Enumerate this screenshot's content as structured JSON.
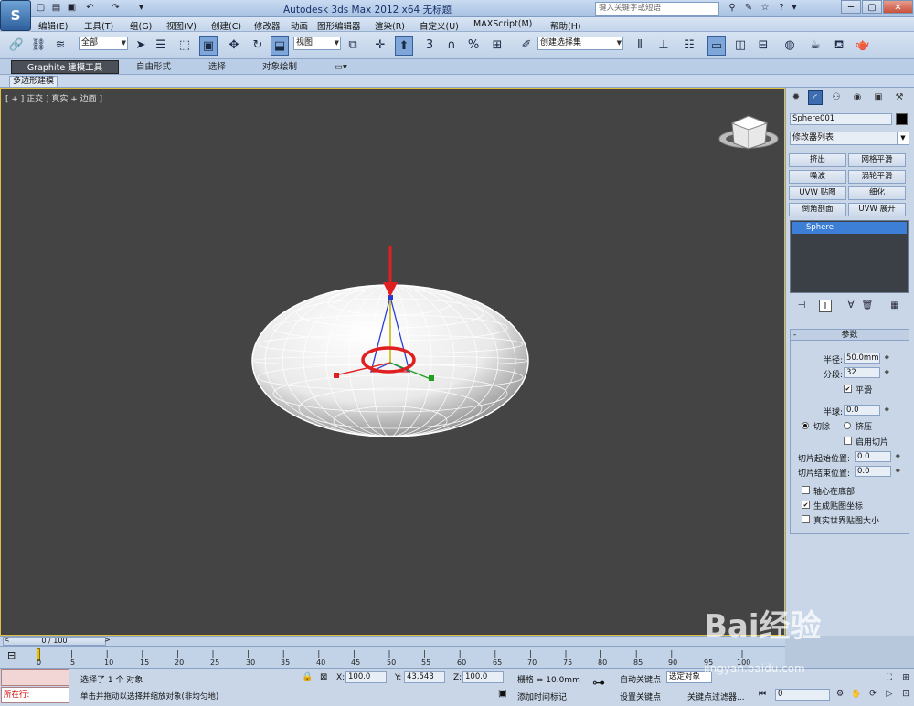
{
  "window": {
    "logo": "S",
    "title": "Autodesk 3ds Max  2012 x64      无标题",
    "search_placeholder": "键入关键字或短语"
  },
  "menu": [
    "编辑(E)",
    "工具(T)",
    "组(G)",
    "视图(V)",
    "创建(C)",
    "修改器",
    "动画",
    "图形编辑器",
    "渲染(R)",
    "自定义(U)",
    "MAXScript(M)",
    "帮助(H)"
  ],
  "toolbar": {
    "selection_filter": "全部",
    "ref_coord": "视图",
    "named_selection": "创建选择集",
    "snap_value": "3"
  },
  "ribbon": {
    "tabs": [
      "Graphite 建模工具",
      "自由形式",
      "选择",
      "对象绘制"
    ],
    "sub_label": "多边形建模"
  },
  "viewport": {
    "label": "[ + ] 正交 ] 真实 + 边面 ]",
    "object": "Sphere001",
    "selected": true
  },
  "command_panel": {
    "object_name": "Sphere001",
    "object_color": "#000000",
    "modifier_list": "修改器列表",
    "modifier_buttons": [
      "挤出",
      "网格平滑",
      "噪波",
      "涡轮平滑",
      "UVW 贴图",
      "细化",
      "倒角剖面",
      "UVW 展开"
    ],
    "stack_item": "Sphere",
    "params": {
      "title": "参数",
      "radius_label": "半径:",
      "radius": "50.0mm",
      "segments_label": "分段:",
      "segments": "32",
      "smooth_label": "平滑",
      "smooth": true,
      "hemisphere_label": "半球:",
      "hemisphere": "0.0",
      "chop_label": "切除",
      "squash_label": "挤压",
      "slice_on_label": "启用切片",
      "slice_from_label": "切片起始位置:",
      "slice_from": "0.0",
      "slice_to_label": "切片结束位置:",
      "slice_to": "0.0",
      "base_to_pivot_label": "轴心在底部",
      "gen_mapping_label": "生成贴图坐标",
      "gen_mapping": true,
      "real_world_label": "真实世界贴图大小"
    }
  },
  "timeline": {
    "slider": "0 / 100",
    "ticks": [
      "0",
      "5",
      "10",
      "15",
      "20",
      "25",
      "30",
      "35",
      "40",
      "45",
      "50",
      "55",
      "60",
      "65",
      "70",
      "75",
      "80",
      "85",
      "90",
      "95",
      "100"
    ]
  },
  "status": {
    "maxscript_label": "所在行:",
    "line1": "选择了 1 个 对象",
    "line2": "单击并拖动以选择并缩放对象(非均匀地)",
    "x_label": "X:",
    "x": "100.0",
    "y_label": "Y:",
    "y": "43.543",
    "z_label": "Z:",
    "z": "100.0",
    "grid": "栅格 = 10.0mm",
    "add_time_tag": "添加时间标记",
    "auto_key": "自动关键点",
    "selected_dropdown": "选定对象",
    "set_key": "设置关键点",
    "key_filters": "关键点过滤器...",
    "frame": "0"
  },
  "watermark": {
    "text": "Bai经验",
    "url": "jingyan.baidu.com"
  },
  "colors": {
    "viewport_bg": "#444444",
    "panel_bg": "#c8d6e8",
    "selection_active": "#3d7fd6",
    "annotation_red": "#e02020"
  }
}
